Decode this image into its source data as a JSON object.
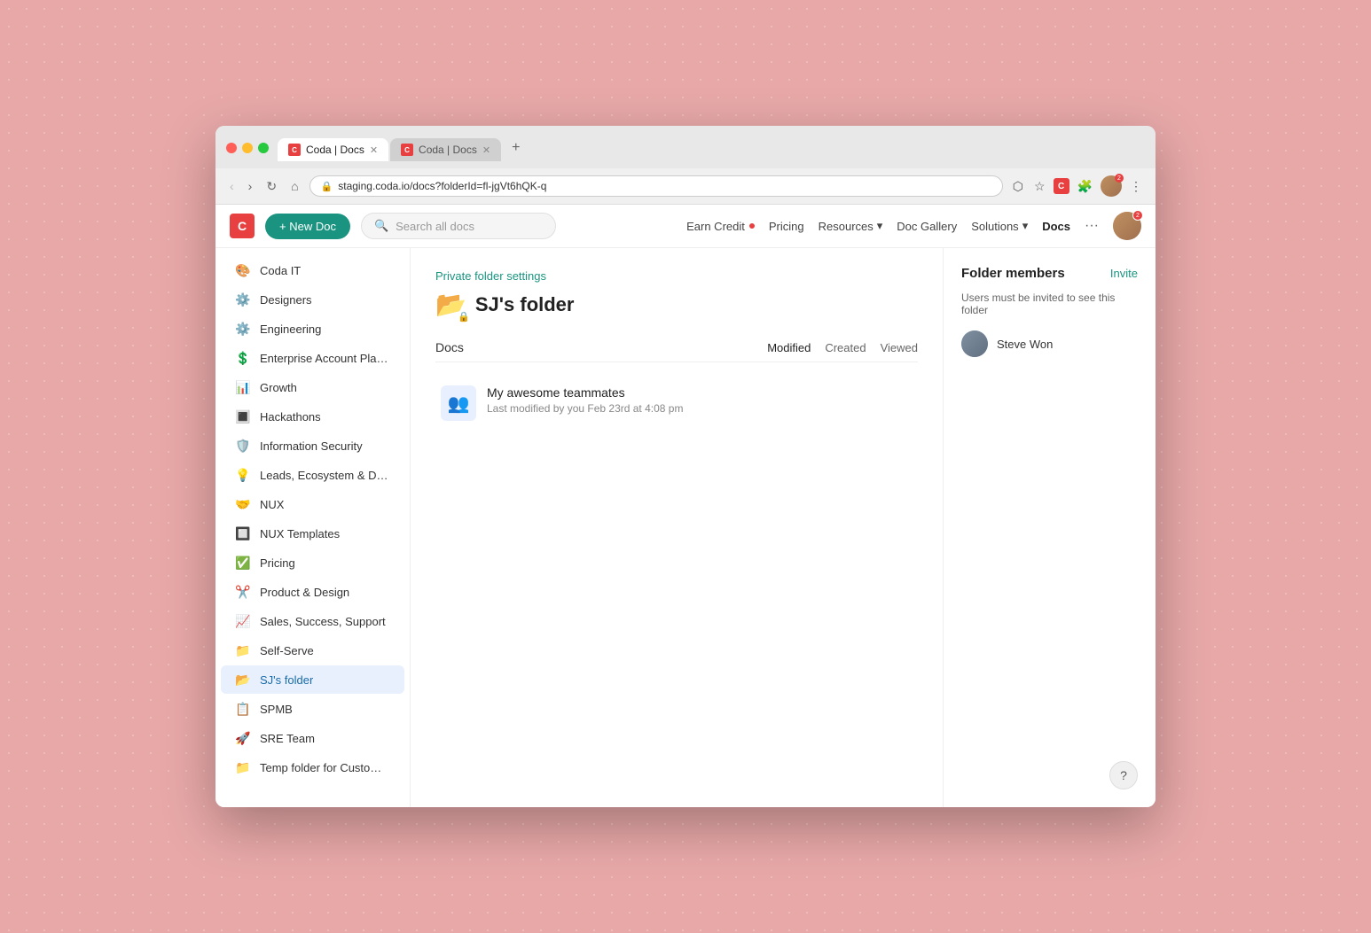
{
  "browser": {
    "tabs": [
      {
        "label": "Coda | Docs",
        "active": true,
        "icon": "C"
      },
      {
        "label": "Coda | Docs",
        "active": false,
        "icon": "C"
      }
    ],
    "url": "staging.coda.io/docs?folderId=fl-jgVt6hQK-q",
    "new_tab_label": "+"
  },
  "nav": {
    "logo": "C",
    "new_doc_label": "+ New Doc",
    "search_placeholder": "Search all docs",
    "links": [
      {
        "label": "Earn Credit",
        "has_dot": true
      },
      {
        "label": "Pricing",
        "has_dot": false
      },
      {
        "label": "Resources",
        "has_dot": false,
        "has_arrow": true
      },
      {
        "label": "Doc Gallery",
        "has_dot": false
      },
      {
        "label": "Solutions",
        "has_dot": false,
        "has_arrow": true
      },
      {
        "label": "Docs",
        "has_dot": false,
        "active": true
      }
    ],
    "more_label": "···",
    "user_badge": "2"
  },
  "sidebar": {
    "items": [
      {
        "label": "Coda IT",
        "icon": "🎨"
      },
      {
        "label": "Designers",
        "icon": "⚙️"
      },
      {
        "label": "Engineering",
        "icon": "⚙️"
      },
      {
        "label": "Enterprise Account Plans ...",
        "icon": "💲"
      },
      {
        "label": "Growth",
        "icon": "📊"
      },
      {
        "label": "Hackathons",
        "icon": "🔳"
      },
      {
        "label": "Information Security",
        "icon": "🛡️"
      },
      {
        "label": "Leads, Ecosystem & Dem...",
        "icon": "💡"
      },
      {
        "label": "NUX",
        "icon": "🤝"
      },
      {
        "label": "NUX Templates",
        "icon": "🔲"
      },
      {
        "label": "Pricing",
        "icon": "✅"
      },
      {
        "label": "Product & Design",
        "icon": "✂️"
      },
      {
        "label": "Sales, Success, Support",
        "icon": "📈"
      },
      {
        "label": "Self-Serve",
        "icon": "📁"
      },
      {
        "label": "SJ's folder",
        "icon": "📂",
        "active": true
      },
      {
        "label": "SPMB",
        "icon": "📋"
      },
      {
        "label": "SRE Team",
        "icon": "🚀"
      },
      {
        "label": "Temp folder for Custom T...",
        "icon": "📁"
      }
    ]
  },
  "folder": {
    "private_settings_label": "Private folder settings",
    "name": "SJ's folder",
    "icon": "📂",
    "docs_label": "Docs",
    "sort_options": [
      {
        "label": "Modified",
        "active": true
      },
      {
        "label": "Created",
        "active": false
      },
      {
        "label": "Viewed",
        "active": false
      }
    ],
    "docs": [
      {
        "name": "My awesome teammates",
        "meta": "Last modified by you Feb 23rd at 4:08 pm",
        "icon": "👥"
      }
    ]
  },
  "members": {
    "title": "Folder members",
    "invite_label": "Invite",
    "description": "Users must be invited to see this folder",
    "items": [
      {
        "name": "Steve Won"
      }
    ],
    "help_label": "?"
  }
}
